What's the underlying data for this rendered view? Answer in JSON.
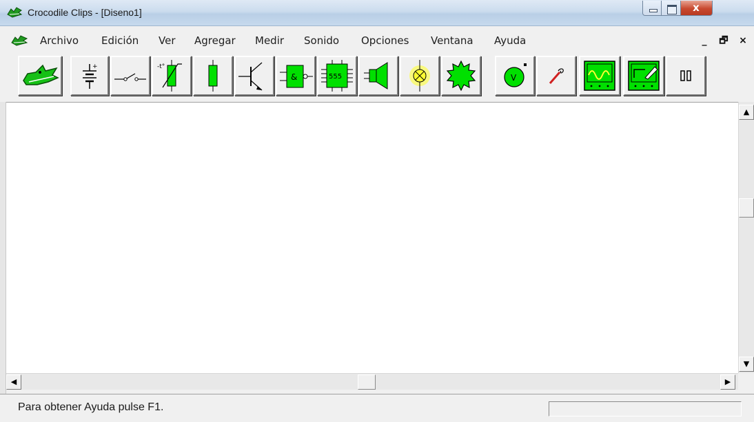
{
  "window": {
    "title": "Crocodile Clips - [Diseno1]",
    "close_glyph": "x"
  },
  "menu": {
    "items": [
      "Archivo",
      "Edición",
      "Ver",
      "Agregar",
      "Medir",
      "Sonido",
      "Opciones",
      "Ventana",
      "Ayuda"
    ],
    "mdi_minimize": "_",
    "mdi_restore": "🗗",
    "mdi_close": "×"
  },
  "toolbar": {
    "logic_gate_label": "&",
    "timer_label": "555",
    "meter_label": "V",
    "tools": [
      "crocodile-logo-icon",
      "battery-icon",
      "switch-icon",
      "thermistor-icon",
      "resistor-icon",
      "transistor-icon",
      "logic-gate-icon",
      "ic-555-icon",
      "speaker-icon",
      "lamp-icon",
      "motor-icon",
      "voltmeter-icon",
      "probe-icon",
      "oscilloscope-icon",
      "graph-icon",
      "pause-icon"
    ]
  },
  "scroll": {
    "up": "▲",
    "down": "▼",
    "left": "◀",
    "right": "▶"
  },
  "status": {
    "text": "Para obtener Ayuda pulse F1."
  },
  "colors": {
    "component_green": "#00e000",
    "lamp_yellow": "#ffff33"
  }
}
